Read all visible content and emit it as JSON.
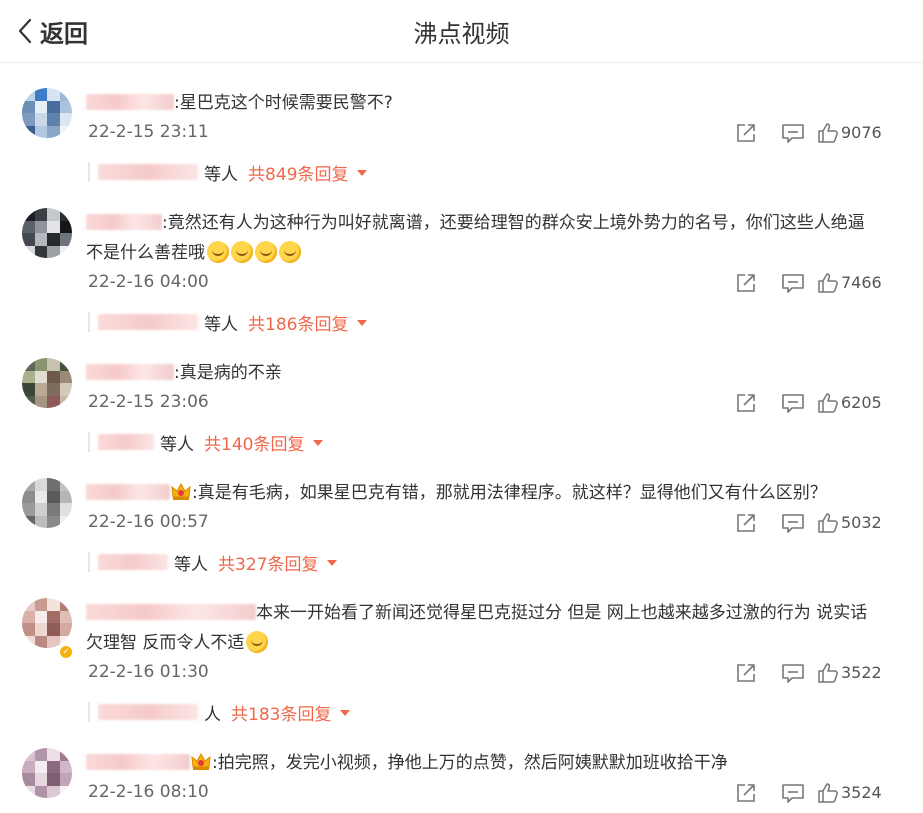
{
  "header": {
    "back_label": "返回",
    "title": "沸点视频"
  },
  "comments": [
    {
      "text": ":星巴克这个时候需要民警不?",
      "time": "22-2-15 23:11",
      "likes": "9076",
      "reply_suffix": "等人",
      "reply_count": "共849条回复",
      "avatar_colors": [
        "#bcd4ec",
        "#3f7cc6",
        "#d6e4f2",
        "#9cb9da",
        "#6c8fb8",
        "#e8eef5",
        "#4a6c9a",
        "#a9c2de",
        "#7e9bbf",
        "#c9d8ea",
        "#5e82ad",
        "#dbe6f1",
        "#3b5f8a",
        "#b1c8e0",
        "#8aa6c6",
        "#eef3f8"
      ]
    },
    {
      "text_line1": ":竟然还有人为这种行为叫好就离谱，还要给理智的群众安上境外势力的名号，你们这些人绝逼",
      "text_line2": "不是什么善茬哦",
      "time": "22-2-16 04:00",
      "likes": "7466",
      "reply_suffix": "等人",
      "reply_count": "共186条回复",
      "avatar_colors": [
        "#1c1f24",
        "#3a3e45",
        "#c4c7cc",
        "#2a2d33",
        "#5c6068",
        "#8f939a",
        "#e2e4e7",
        "#14161a",
        "#44484f",
        "#b5b8bd",
        "#26292e",
        "#6f737a",
        "#d6d8db",
        "#33363c",
        "#9da1a7",
        "#f0f1f3"
      ]
    },
    {
      "text": ":真是病的不亲",
      "time": "22-2-15 23:06",
      "likes": "6205",
      "reply_suffix": "等人",
      "reply_count": "共140条回复",
      "avatar_colors": [
        "#5f6a52",
        "#8a9470",
        "#c7c2b0",
        "#43503c",
        "#aab18f",
        "#e2ddd0",
        "#6e5a4c",
        "#9a8a78",
        "#3c4638",
        "#b9a896",
        "#7c6d5e",
        "#d3cab8",
        "#51594a",
        "#a59683",
        "#8c5a58",
        "#c9b9a6"
      ]
    },
    {
      "text": ":真是有毛病，如果星巴克有错，那就用法律程序。就这样？显得他们又有什么区别？",
      "time": "22-2-16 00:57",
      "likes": "5032",
      "reply_suffix": "等人",
      "reply_count": "共327条回复",
      "avatar_colors": [
        "#a8a8a8",
        "#d9d9d9",
        "#6f6f6f",
        "#c2c2c2",
        "#8d8d8d",
        "#eaeaea",
        "#5a5a5a",
        "#b5b5b5",
        "#9a9a9a",
        "#cfcfcf",
        "#7a7a7a",
        "#e0e0e0",
        "#666666",
        "#bcbcbc",
        "#8a8a8a",
        "#f0f0f0"
      ]
    },
    {
      "text_line1": "本来一开始看了新闻还觉得星巴克挺过分 但是 网上也越来越多过激的行为 说实话",
      "text_line2": "欠理智 反而令人不适",
      "time": "22-2-16 01:30",
      "likes": "3522",
      "reply_suffix": "人",
      "reply_count": "共183条回复",
      "avatar_colors": [
        "#e8c9c3",
        "#c89b92",
        "#f3e2de",
        "#b07d74",
        "#d9b1a8",
        "#f7ece9",
        "#a06c63",
        "#e0bdb5",
        "#c18f86",
        "#efd6d1",
        "#8e5d55",
        "#d4a9a0",
        "#f0dcd8",
        "#b88a82",
        "#e6c5be",
        "#faf1ef"
      ]
    },
    {
      "text": ":拍完照，发完小视频，挣他上万的点赞，然后阿姨默默加班收拾干净",
      "time": "22-2-16 08:10",
      "likes": "3524",
      "avatar_colors": [
        "#d8c2d0",
        "#b496aa",
        "#ecdfe7",
        "#9c7a90",
        "#c9adbe",
        "#f4ecf1",
        "#8a6a7e",
        "#d0b8c7",
        "#a88aa0",
        "#e6d6e0",
        "#7d5e72",
        "#c2a4b7",
        "#ebdde6",
        "#b093a6",
        "#dcc8d4",
        "#f8f2f6"
      ]
    }
  ]
}
